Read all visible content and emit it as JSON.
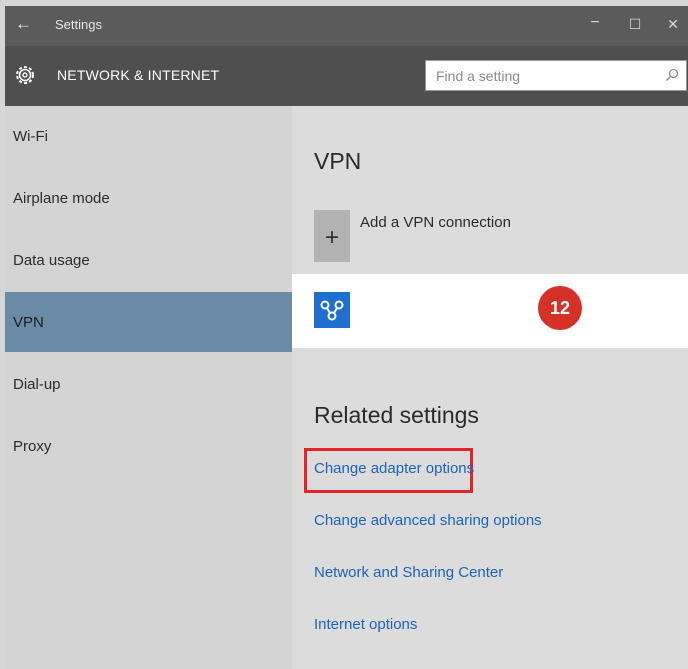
{
  "window": {
    "title": "Settings",
    "back_icon": "←",
    "minimize": "−",
    "maximize": "☐",
    "close": "✕"
  },
  "header": {
    "section_title": "NETWORK & INTERNET",
    "search_placeholder": "Find a setting",
    "gear_icon": "gear-icon",
    "search_icon": "search-icon"
  },
  "sidebar": {
    "items": [
      {
        "label": "Wi-Fi"
      },
      {
        "label": "Airplane mode"
      },
      {
        "label": "Data usage"
      },
      {
        "label": "VPN",
        "selected": true
      },
      {
        "label": "Dial-up"
      },
      {
        "label": "Proxy"
      }
    ]
  },
  "main": {
    "heading": "VPN",
    "add_vpn_label": "Add a VPN connection",
    "add_icon": "+",
    "vpn_entry_icon": "vpn-icon",
    "badge_number": "12",
    "related_heading": "Related settings",
    "links": [
      "Change adapter options",
      "Change advanced sharing options",
      "Network and Sharing Center",
      "Internet options"
    ]
  },
  "colors": {
    "accent_selected": "#6b8aa5",
    "link": "#1a63b8",
    "badge": "#d63127",
    "highlight_box": "#e4232b",
    "vpn_icon_bg": "#1f6fcf"
  }
}
